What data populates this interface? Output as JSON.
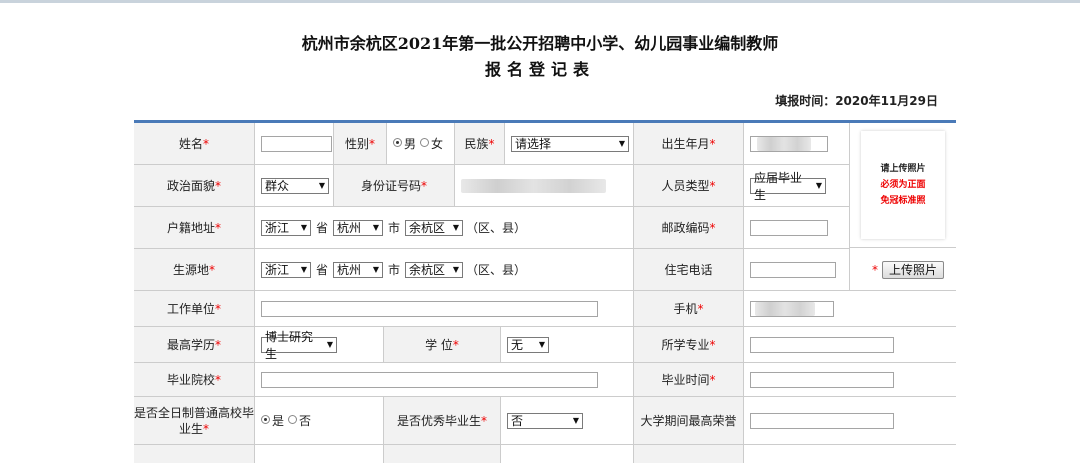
{
  "header": {
    "title_line1": "杭州市余杭区2021年第一批公开招聘中小学、幼儿园事业编制教师",
    "title_line2": "报名登记表",
    "fill_time": "填报时间：2020年11月29日"
  },
  "required_mark": "*",
  "photo": {
    "line1": "请上传照片",
    "line2": "必须为正面",
    "line3": "免冠标准照",
    "upload_button": "上传照片"
  },
  "fields": {
    "name_label": "姓名",
    "gender_label": "性别",
    "gender_male": "男",
    "gender_female": "女",
    "ethnicity_label": "民族",
    "ethnicity_value": "请选择",
    "birth_label": "出生年月",
    "political_label": "政治面貌",
    "political_value": "群众",
    "idcard_label": "身份证号码",
    "person_type_label": "人员类型",
    "person_type_value": "应届毕业生",
    "huji_label": "户籍地址",
    "huji_province": "浙江",
    "huji_city": "杭州",
    "huji_district": "余杭区",
    "province_unit": "省",
    "city_unit": "市",
    "district_unit": "（区、县）",
    "postcode_label": "邮政编码",
    "origin_label": "生源地",
    "origin_province": "浙江",
    "origin_city": "杭州",
    "origin_district": "余杭区",
    "home_phone_label": "住宅电话",
    "work_unit_label": "工作单位",
    "mobile_label": "手机",
    "education_label": "最高学历",
    "education_value": "博士研究生",
    "degree_label": "学 位",
    "degree_value": "无",
    "major_label": "所学专业",
    "school_label": "毕业院校",
    "grad_time_label": "毕业时间",
    "fulltime_label": "是否全日制普通高校毕业生",
    "fulltime_yes": "是",
    "fulltime_no": "否",
    "excellent_label": "是否优秀毕业生",
    "excellent_value": "否",
    "honor_label": "大学期间最高荣誉"
  }
}
